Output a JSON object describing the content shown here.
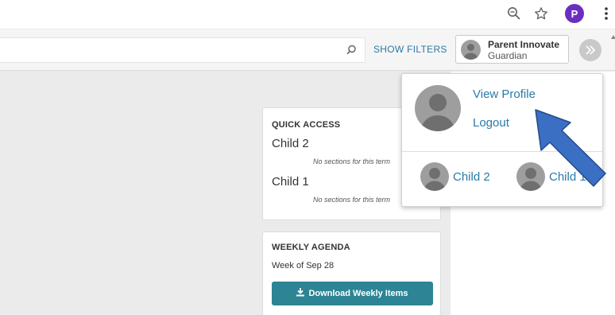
{
  "header": {
    "show_filters": "SHOW FILTERS",
    "user_name": "Parent Innovate",
    "user_role": "Guardian",
    "browser_avatar_letter": "P"
  },
  "quick_access": {
    "title": "QUICK ACCESS",
    "items": [
      {
        "name": "Child 2",
        "note": "No sections for this term"
      },
      {
        "name": "Child 1",
        "note": "No sections for this term"
      }
    ]
  },
  "weekly_agenda": {
    "title": "WEEKLY AGENDA",
    "week_label": "Week of Sep 28",
    "download_label": "Download Weekly Items"
  },
  "dropdown": {
    "view_profile": "View Profile",
    "logout": "Logout",
    "children": [
      "Child 2",
      "Child 1"
    ]
  },
  "icons": {
    "zoom": "magnify-icon",
    "star": "star-icon",
    "menu": "kebab-menu-icon",
    "search": "search-icon",
    "expand": "double-chevron-icon",
    "download": "download-icon",
    "annotation": "blue-arrow"
  },
  "colors": {
    "accent": "#2a7aa6",
    "button": "#2d8494",
    "browser_avatar": "#6a2fc1",
    "arrow": "#3a6fc4"
  }
}
